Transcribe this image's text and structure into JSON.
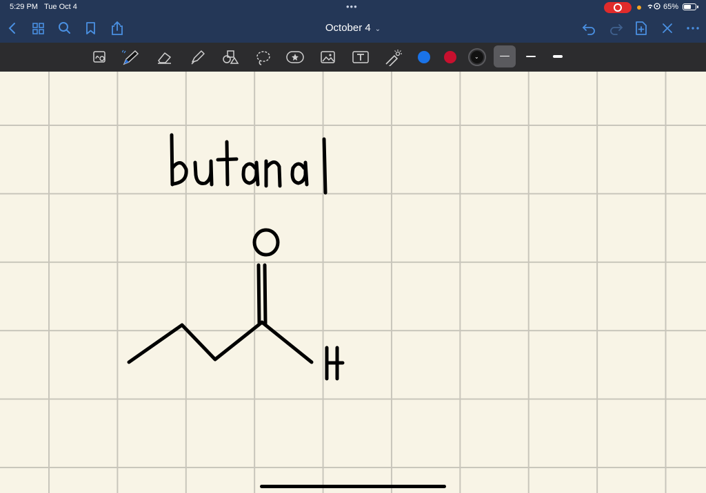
{
  "status_bar": {
    "time": "5:29 PM",
    "date": "Tue Oct 4",
    "battery_percent": "65%",
    "battery_level": 0.65
  },
  "nav_bar": {
    "title": "October 4",
    "icons": [
      "back-icon",
      "thumbnails-icon",
      "search-icon",
      "bookmark-icon",
      "share-icon",
      "undo-icon",
      "redo-icon",
      "add-page-icon",
      "close-icon",
      "more-icon"
    ]
  },
  "toolbar": {
    "tools": [
      "zoom-window-tool",
      "pen-tool",
      "eraser-tool",
      "highlighter-tool",
      "shapes-tool",
      "lasso-tool",
      "elements-tool",
      "image-tool",
      "text-tool",
      "laser-pointer-tool"
    ],
    "colors": [
      "#1a73e8",
      "#c8102e",
      "#111111"
    ],
    "selected_color": "#111111"
  },
  "note": {
    "heading": "butanal",
    "atom_o": "O",
    "atom_h": "H"
  }
}
